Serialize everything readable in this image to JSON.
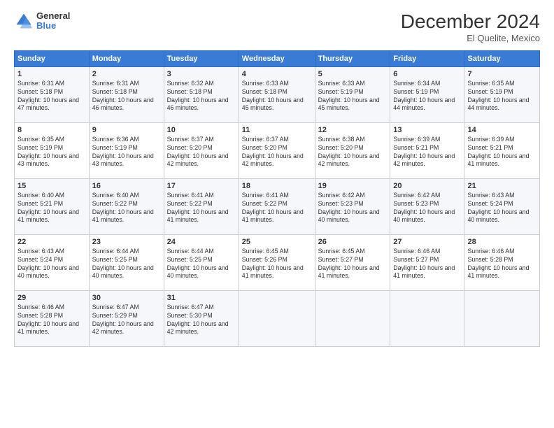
{
  "header": {
    "logo_general": "General",
    "logo_blue": "Blue",
    "title": "December 2024",
    "subtitle": "El Quelite, Mexico"
  },
  "calendar": {
    "headers": [
      "Sunday",
      "Monday",
      "Tuesday",
      "Wednesday",
      "Thursday",
      "Friday",
      "Saturday"
    ],
    "rows": [
      [
        {
          "day": "1",
          "sunrise": "6:31 AM",
          "sunset": "5:18 PM",
          "daylight": "10 hours and 47 minutes."
        },
        {
          "day": "2",
          "sunrise": "6:31 AM",
          "sunset": "5:18 PM",
          "daylight": "10 hours and 46 minutes."
        },
        {
          "day": "3",
          "sunrise": "6:32 AM",
          "sunset": "5:18 PM",
          "daylight": "10 hours and 46 minutes."
        },
        {
          "day": "4",
          "sunrise": "6:33 AM",
          "sunset": "5:18 PM",
          "daylight": "10 hours and 45 minutes."
        },
        {
          "day": "5",
          "sunrise": "6:33 AM",
          "sunset": "5:19 PM",
          "daylight": "10 hours and 45 minutes."
        },
        {
          "day": "6",
          "sunrise": "6:34 AM",
          "sunset": "5:19 PM",
          "daylight": "10 hours and 44 minutes."
        },
        {
          "day": "7",
          "sunrise": "6:35 AM",
          "sunset": "5:19 PM",
          "daylight": "10 hours and 44 minutes."
        }
      ],
      [
        {
          "day": "8",
          "sunrise": "6:35 AM",
          "sunset": "5:19 PM",
          "daylight": "10 hours and 43 minutes."
        },
        {
          "day": "9",
          "sunrise": "6:36 AM",
          "sunset": "5:19 PM",
          "daylight": "10 hours and 43 minutes."
        },
        {
          "day": "10",
          "sunrise": "6:37 AM",
          "sunset": "5:20 PM",
          "daylight": "10 hours and 42 minutes."
        },
        {
          "day": "11",
          "sunrise": "6:37 AM",
          "sunset": "5:20 PM",
          "daylight": "10 hours and 42 minutes."
        },
        {
          "day": "12",
          "sunrise": "6:38 AM",
          "sunset": "5:20 PM",
          "daylight": "10 hours and 42 minutes."
        },
        {
          "day": "13",
          "sunrise": "6:39 AM",
          "sunset": "5:21 PM",
          "daylight": "10 hours and 42 minutes."
        },
        {
          "day": "14",
          "sunrise": "6:39 AM",
          "sunset": "5:21 PM",
          "daylight": "10 hours and 41 minutes."
        }
      ],
      [
        {
          "day": "15",
          "sunrise": "6:40 AM",
          "sunset": "5:21 PM",
          "daylight": "10 hours and 41 minutes."
        },
        {
          "day": "16",
          "sunrise": "6:40 AM",
          "sunset": "5:22 PM",
          "daylight": "10 hours and 41 minutes."
        },
        {
          "day": "17",
          "sunrise": "6:41 AM",
          "sunset": "5:22 PM",
          "daylight": "10 hours and 41 minutes."
        },
        {
          "day": "18",
          "sunrise": "6:41 AM",
          "sunset": "5:22 PM",
          "daylight": "10 hours and 41 minutes."
        },
        {
          "day": "19",
          "sunrise": "6:42 AM",
          "sunset": "5:23 PM",
          "daylight": "10 hours and 40 minutes."
        },
        {
          "day": "20",
          "sunrise": "6:42 AM",
          "sunset": "5:23 PM",
          "daylight": "10 hours and 40 minutes."
        },
        {
          "day": "21",
          "sunrise": "6:43 AM",
          "sunset": "5:24 PM",
          "daylight": "10 hours and 40 minutes."
        }
      ],
      [
        {
          "day": "22",
          "sunrise": "6:43 AM",
          "sunset": "5:24 PM",
          "daylight": "10 hours and 40 minutes."
        },
        {
          "day": "23",
          "sunrise": "6:44 AM",
          "sunset": "5:25 PM",
          "daylight": "10 hours and 40 minutes."
        },
        {
          "day": "24",
          "sunrise": "6:44 AM",
          "sunset": "5:25 PM",
          "daylight": "10 hours and 40 minutes."
        },
        {
          "day": "25",
          "sunrise": "6:45 AM",
          "sunset": "5:26 PM",
          "daylight": "10 hours and 41 minutes."
        },
        {
          "day": "26",
          "sunrise": "6:45 AM",
          "sunset": "5:27 PM",
          "daylight": "10 hours and 41 minutes."
        },
        {
          "day": "27",
          "sunrise": "6:46 AM",
          "sunset": "5:27 PM",
          "daylight": "10 hours and 41 minutes."
        },
        {
          "day": "28",
          "sunrise": "6:46 AM",
          "sunset": "5:28 PM",
          "daylight": "10 hours and 41 minutes."
        }
      ],
      [
        {
          "day": "29",
          "sunrise": "6:46 AM",
          "sunset": "5:28 PM",
          "daylight": "10 hours and 41 minutes."
        },
        {
          "day": "30",
          "sunrise": "6:47 AM",
          "sunset": "5:29 PM",
          "daylight": "10 hours and 42 minutes."
        },
        {
          "day": "31",
          "sunrise": "6:47 AM",
          "sunset": "5:30 PM",
          "daylight": "10 hours and 42 minutes."
        },
        null,
        null,
        null,
        null
      ]
    ]
  }
}
